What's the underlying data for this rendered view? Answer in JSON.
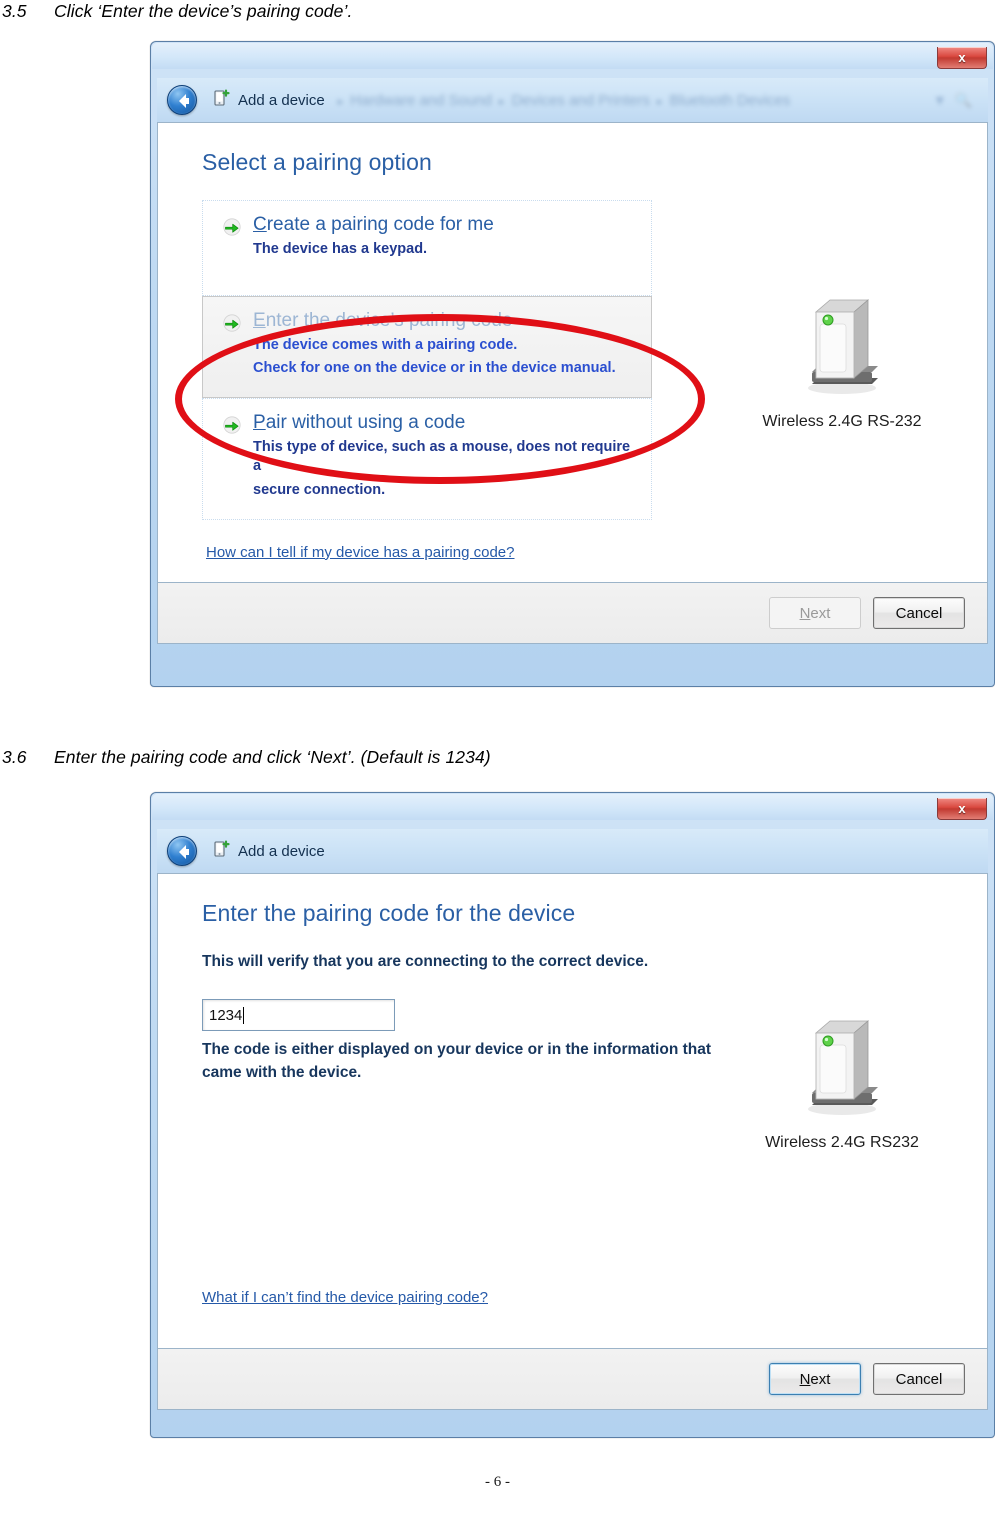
{
  "document": {
    "step_35": {
      "number": "3.5",
      "text": "Click ‘Enter the device’s pairing code’."
    },
    "step_36": {
      "number": "3.6",
      "text": "Enter the pairing code and click ‘Next’. (Default is 1234)"
    },
    "page_number": "- 6 -"
  },
  "dialog1": {
    "close_label": "x",
    "nav": {
      "title": "Add a device",
      "breadcrumb": [
        "Hardware and Sound",
        "Devices and Printers",
        "Bluetooth Devices"
      ],
      "separator": "▸"
    },
    "heading": "Select a pairing option",
    "options": [
      {
        "accel": "C",
        "title_rest": "reate a pairing code for me",
        "title_full": "Create a pairing code for me",
        "desc": [
          "The device has a keypad."
        ],
        "state": "normal"
      },
      {
        "accel": "E",
        "title_rest": "nter the device’s pairing code",
        "title_full": "Enter the device’s pairing code",
        "desc": [
          "The device comes with a pairing code.",
          "Check for one on the device or in the device manual."
        ],
        "state": "hovered"
      },
      {
        "accel": "P",
        "title_rest": "air without using a code",
        "title_full": "Pair without using a code",
        "desc": [
          "This type of device, such as a mouse, does not require a",
          "secure connection."
        ],
        "state": "normal"
      }
    ],
    "help_link": " How can I tell if my device has a pairing code?",
    "device_caption": "Wireless 2.4G RS-232",
    "buttons": {
      "next_accel": "N",
      "next_rest": "ext",
      "next_label": "Next",
      "next_enabled": false,
      "cancel_label": "Cancel"
    }
  },
  "dialog2": {
    "close_label": "x",
    "nav": {
      "title": "Add a device"
    },
    "heading": "Enter the pairing code for the device",
    "intro_text": "This will verify that you are connecting to the correct device.",
    "code_value": "1234",
    "code_placeholder": "",
    "hint_lines": [
      "The code is either displayed on your device or in the information that",
      "came with the device."
    ],
    "help_link": "What if I can’t find the device pairing code?",
    "device_caption": "Wireless 2.4G RS232",
    "buttons": {
      "next_accel": "N",
      "next_rest": "ext",
      "next_label": "Next",
      "next_enabled": true,
      "cancel_label": "Cancel"
    }
  },
  "colors": {
    "heading_blue": "#2a5fa5",
    "link_blue": "#2559a8",
    "annotation_red": "#e00f16",
    "desc_blue": "#21398f",
    "title_bar_blue": "#c3dcf4"
  }
}
